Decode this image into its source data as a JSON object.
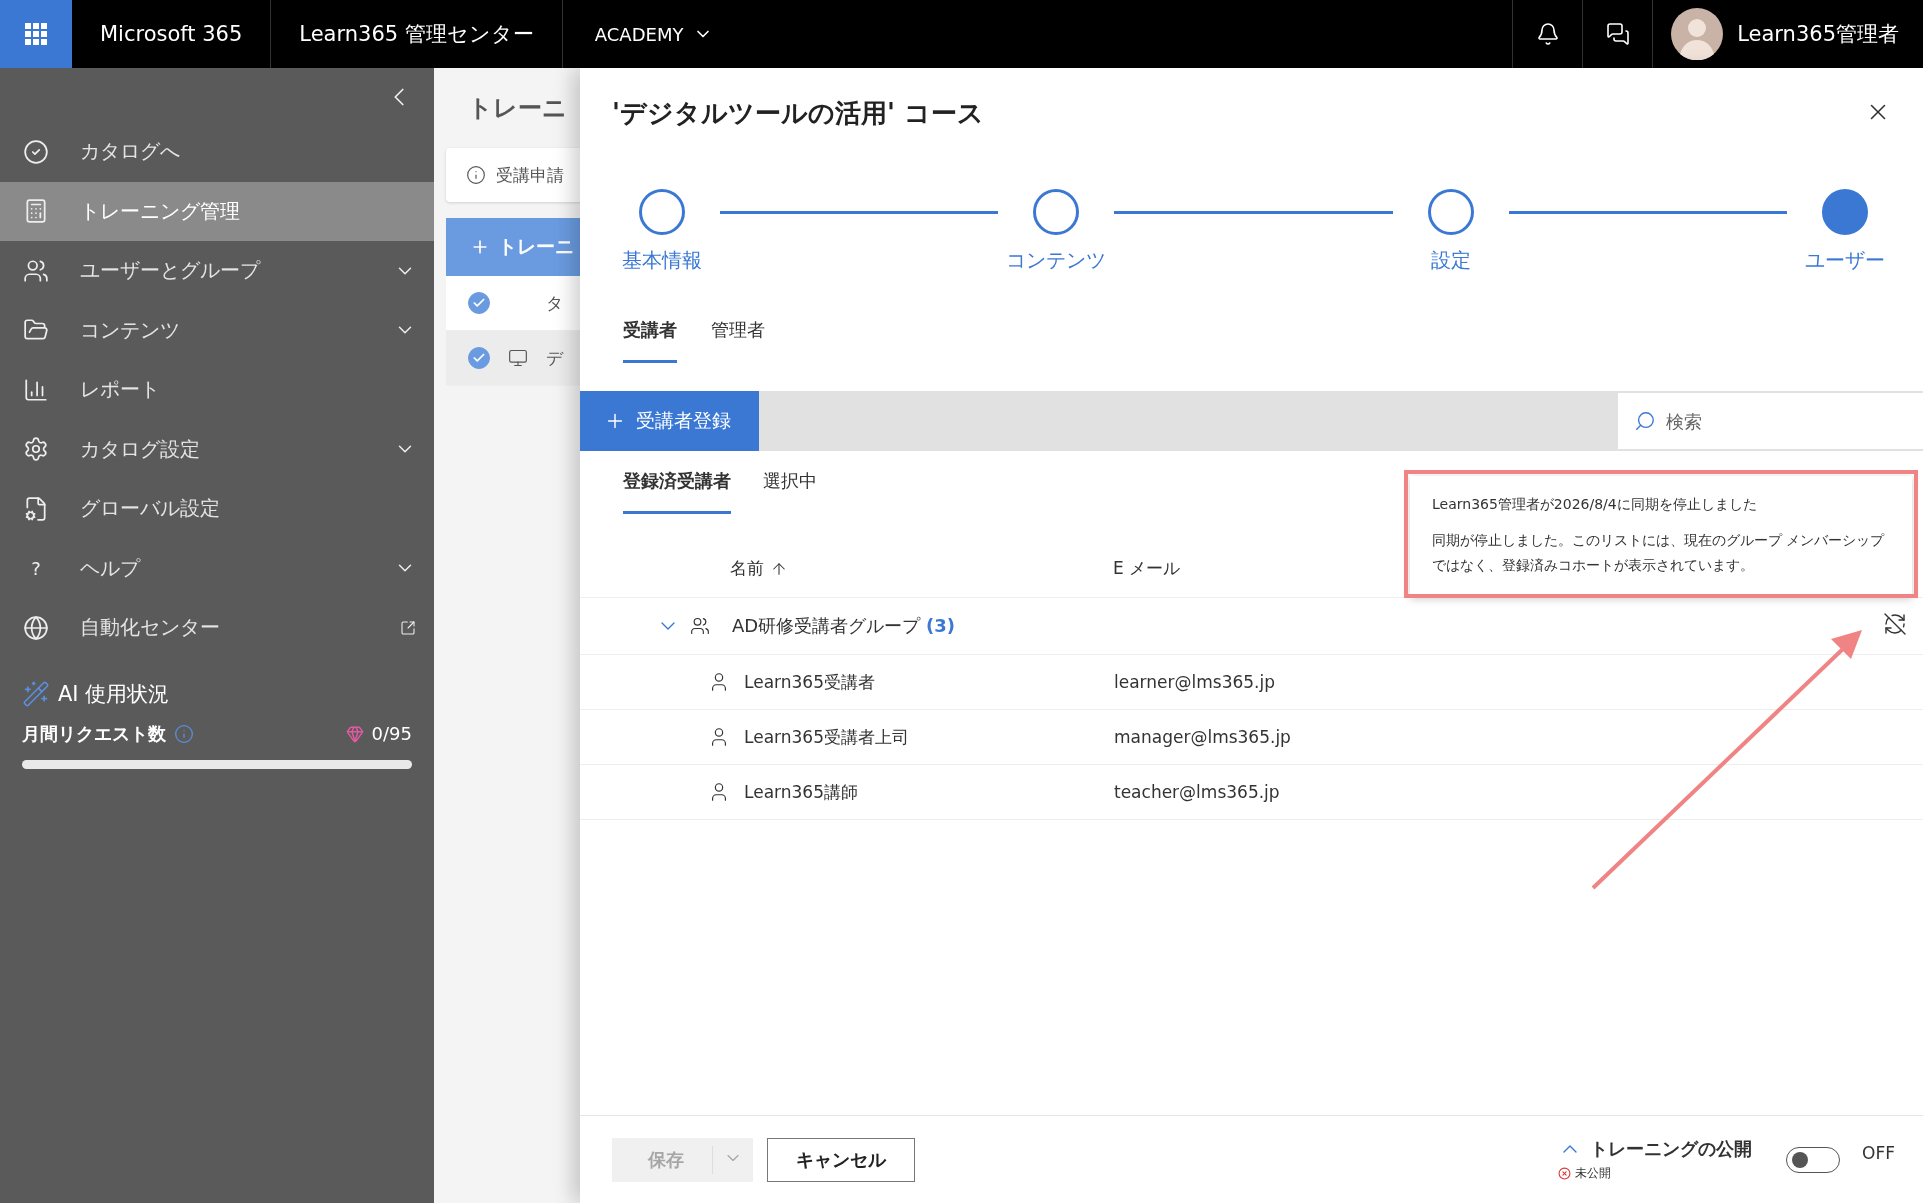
{
  "top_bar": {
    "app_name": "Microsoft 365",
    "center_name": "Learn365 管理センター",
    "tenant": "ACADEMY",
    "user_name": "Learn365管理者"
  },
  "sidebar": {
    "items": [
      {
        "kind": "catalog",
        "label": "カタログへ",
        "selected": false,
        "expandable": false,
        "external": false
      },
      {
        "kind": "training",
        "label": "トレーニング管理",
        "selected": true,
        "expandable": false,
        "external": false
      },
      {
        "kind": "users",
        "label": "ユーザーとグループ",
        "selected": false,
        "expandable": true,
        "external": false
      },
      {
        "kind": "content",
        "label": "コンテンツ",
        "selected": false,
        "expandable": true,
        "external": false
      },
      {
        "kind": "report",
        "label": "レポート",
        "selected": false,
        "expandable": false,
        "external": false
      },
      {
        "kind": "settings",
        "label": "カタログ設定",
        "selected": false,
        "expandable": true,
        "external": false
      },
      {
        "kind": "global",
        "label": "グローバル設定",
        "selected": false,
        "expandable": false,
        "external": false
      },
      {
        "kind": "help",
        "glyph": "?",
        "label": "ヘルプ",
        "selected": false,
        "expandable": true,
        "external": false
      },
      {
        "kind": "automation",
        "label": "自動化センター",
        "selected": false,
        "expandable": false,
        "external": true
      }
    ],
    "ai_usage": {
      "title": "AI 使用状況",
      "label": "月間リクエスト数",
      "count": "0/95"
    }
  },
  "background_page": {
    "title": "トレーニ",
    "notice": "受講申請",
    "add_button": "トレーニ",
    "rows": [
      {
        "kind": "header",
        "text": "タ",
        "checked": true,
        "selected": false
      },
      {
        "kind": "course",
        "text": "デ",
        "checked": true,
        "selected": true
      }
    ]
  },
  "panel": {
    "title": "'デジタルツールの活用' コース",
    "steps": [
      {
        "label": "基本情報",
        "current": false
      },
      {
        "label": "コンテンツ",
        "current": false
      },
      {
        "label": "設定",
        "current": false
      },
      {
        "label": "ユーザー",
        "current": true
      }
    ],
    "tabs": [
      {
        "label": "受講者",
        "selected": true
      },
      {
        "label": "管理者",
        "selected": false
      }
    ],
    "add_button": "受講者登録",
    "search": {
      "placeholder": "検索"
    },
    "sub_tabs": [
      {
        "label": "登録済受講者",
        "selected": true
      },
      {
        "label": "選択中",
        "selected": false
      }
    ],
    "table": {
      "columns": [
        {
          "label": "名前",
          "sorted": true
        },
        {
          "label": "E メール",
          "sorted": false
        }
      ],
      "group": {
        "name": "AD研修受講者グループ",
        "count": "(3)",
        "expanded": true,
        "members": [
          {
            "name": "Learn365受講者",
            "email": "learner@lms365.jp"
          },
          {
            "name": "Learn365受講者上司",
            "email": "manager@lms365.jp"
          },
          {
            "name": "Learn365講師",
            "email": "teacher@lms365.jp"
          }
        ]
      }
    },
    "tooltip": {
      "title": "Learn365管理者が2026/8/4に同期を停止しました",
      "body": "同期が停止しました。このリストには、現在のグループ メンバーシップではなく、登録済みコホートが表示されています。"
    },
    "footer": {
      "save": "保存",
      "save_disabled": true,
      "cancel": "キャンセル",
      "publish_label": "トレーニングの公開",
      "status": "未公開",
      "toggle": {
        "on": false,
        "label": "OFF"
      }
    }
  }
}
